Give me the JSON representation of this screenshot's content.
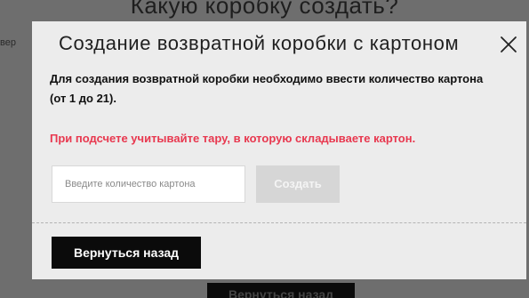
{
  "background": {
    "title": "Какую коробку создать?",
    "left_text_fragment": "вер",
    "back_button_label": "Вернуться назад"
  },
  "modal": {
    "title": "Создание возвратной коробки с картоном",
    "close_icon": "close-icon",
    "description": "Для создания возвратной коробки необходимо ввести количество картона (от 1 до 21).",
    "warning": "При подсчете учитывайте тару, в которую складываете картон.",
    "quantity_input": {
      "placeholder": "Введите количество картона",
      "value": ""
    },
    "create_button_label": "Создать",
    "back_button_label": "Вернуться назад"
  },
  "colors": {
    "overlay": "#6e6e6e",
    "modal_background": "#ececec",
    "warning_text": "#e8384f",
    "primary_button": "#0b0b0b",
    "disabled_button": "#d6d6d6"
  }
}
